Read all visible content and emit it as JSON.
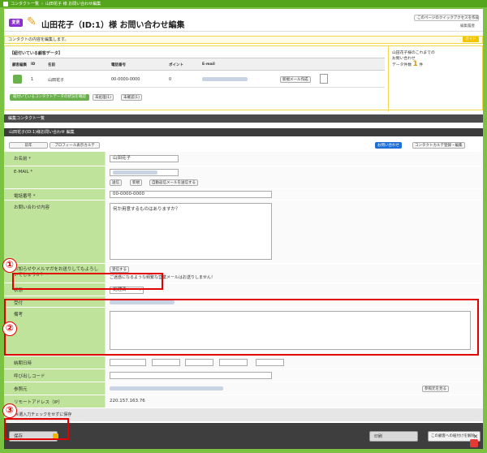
{
  "breadcrumb": [
    "コンタクト一覧",
    "山田花子 様 お問い合わせ編集"
  ],
  "header": {
    "badge": "変更",
    "title": "山田花子（ID:1）様 お問い合わせ編集",
    "quick_access": "このページのクイックアクセスを作成",
    "edit_history": "編集履歴"
  },
  "description": "コンタクトの内容を編集します。",
  "guide_label": "ガイド",
  "linked": {
    "title": "【紐付いている顧客データ】",
    "columns": [
      "顧客編集",
      "ID",
      "名前",
      "電話番号",
      "ポイント",
      "E-mail"
    ],
    "row": {
      "id": "1",
      "name": "山田花子",
      "phone": "00-0000-0000",
      "point": "0"
    },
    "new_mail_button": "新規メール作成",
    "contact_button": "紐付いているコンタクトデータの状況を確認",
    "pending_label": "未処理(1)",
    "unconfirmed_label": "未確認(1)"
  },
  "customer_info": {
    "line1": "山田花子様のこれまでの",
    "line2": "お問い合わせ",
    "count_label": "データ件数",
    "count": "1",
    "unit": "件"
  },
  "list_bar": "編集コンタクト一覧",
  "edit_bar": "山田花子(ID:1)様お問い合わせ 編集",
  "buttons": {
    "prev": "前年",
    "profile": "プロフィール表示カルテ",
    "inquiry": "お問い合わせ",
    "contact_template": "コンタクトカルテ登録・編集"
  },
  "form": {
    "name_label": "お名前",
    "name_value": "山田花子",
    "email_label": "E-MAIL",
    "send_btn": "送信",
    "new_btn": "新規",
    "auto_reply_btn": "自動返信メールを送信する",
    "phone_label": "電話番号",
    "phone_value": "00-0000-0000",
    "inquiry_label": "お問い合わせ内容",
    "inquiry_value": "何か用意するものはありますか？",
    "newsletter_label": "お知らせやメルマガをお送りしてもよろしいでしょうか？",
    "newsletter_value": "受信する",
    "newsletter_note": "ご迷惑になるような頻繁な営業メールはお送りしません！",
    "status_label": "状態",
    "status_value": "処理済",
    "receipt_label": "受付",
    "memo_label": "備考",
    "deadline_label": "納期日時",
    "call_code_label": "呼び出しコード",
    "ref_label": "参照元",
    "ref_button": "参照元を見る",
    "remote_label": "リモートアドレス（IP）",
    "remote_value": "220.157.163.76",
    "footnote": "※選入力チェックをせずに保存"
  },
  "bottom": {
    "save": "保存",
    "print": "印刷",
    "release": "この顧客への紐付けを解除"
  },
  "callouts": [
    "①",
    "②",
    "③"
  ],
  "colors": {
    "accent": "#7cc242",
    "highlight": "#e00000",
    "label_bg": "#bfe39a"
  }
}
